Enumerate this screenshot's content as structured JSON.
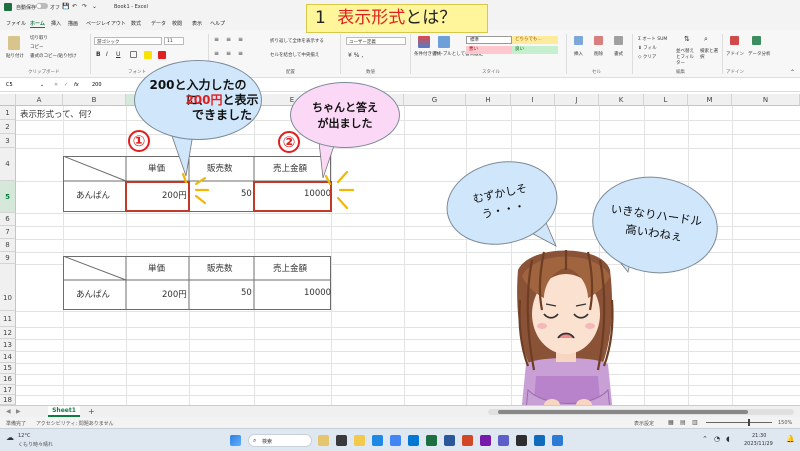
{
  "titlebar": {
    "autosave": "自動保存",
    "autosave_state": "オフ",
    "doc_title": "Book1 - Excel"
  },
  "menu": {
    "tabs": [
      "ファイル",
      "ホーム",
      "挿入",
      "描画",
      "ページレイアウト",
      "数式",
      "データ",
      "校閲",
      "表示",
      "ヘルプ"
    ],
    "active": "ホーム"
  },
  "ribbon": {
    "paste": "貼り付け",
    "cut": "切り取り",
    "copy": "コピー",
    "format_painter": "書式のコピー/貼り付け",
    "clipboard": "クリップボード",
    "font_name": "游ゴシック",
    "font_size": "11",
    "font_group": "フォント",
    "bold": "B",
    "italic": "I",
    "underline": "U",
    "wrap": "折り返して全体を表示する",
    "merge": "セルを結合して中央揃え",
    "align_group": "配置",
    "number_format": "ユーザー定義",
    "number_group": "数値",
    "cond_format": "条件付き書式",
    "table_format": "テーブルとして書式設定",
    "style_normal": "標準",
    "style_neutral": "どちらでも...",
    "style_bad": "悪い",
    "style_good": "良い",
    "style_group": "スタイル",
    "insert": "挿入",
    "delete": "削除",
    "format": "書式",
    "cell_group": "セル",
    "autosum": "オート SUM",
    "fill": "フィル",
    "clear": "クリア",
    "sort_filter": "並べ替えとフィルター",
    "find_select": "検索と選択",
    "edit_group": "編集",
    "addin": "アドイン",
    "addin_group": "アドイン",
    "data_analysis": "データ分析"
  },
  "formula_bar": {
    "name_box": "C5",
    "fx": "fx",
    "value": "200"
  },
  "grid": {
    "columns": [
      "A",
      "B",
      "C",
      "D",
      "E",
      "F",
      "G",
      "H",
      "I",
      "J",
      "K",
      "L",
      "M",
      "N"
    ],
    "rows": [
      "1",
      "2",
      "3",
      "4",
      "5",
      "6",
      "7",
      "8",
      "9",
      "10",
      "11",
      "12",
      "13",
      "14",
      "15",
      "16",
      "17",
      "18"
    ],
    "a1": "表示形式って、何？"
  },
  "table1": {
    "headers": [
      "単価",
      "販売数",
      "売上金額"
    ],
    "row_label": "あんぱん",
    "values": [
      "200円",
      "50",
      "10000"
    ]
  },
  "table2": {
    "headers": [
      "単価",
      "販売数",
      "売上金額"
    ],
    "row_label": "あんぱん",
    "values": [
      "200円",
      "50",
      "10000"
    ]
  },
  "slide_title": {
    "number": "1",
    "highlight": "表示形式",
    "rest": "とは？"
  },
  "callouts": {
    "marker1": "①",
    "marker2": "②",
    "bubble1_part1": "200と入力したのに、",
    "bubble1_red": "200円",
    "bubble1_part2": "と表示できました",
    "bubble2": "ちゃんと答えが出ました",
    "bubble3": "むずかしそう・・・",
    "bubble4": "いきなりハードル高いわねぇ"
  },
  "sheet_tabs": {
    "active": "Sheet1",
    "add": "+"
  },
  "status": {
    "ready": "準備完了",
    "accessibility": "アクセシビリティ: 問題ありません",
    "display_settings": "表示設定",
    "zoom": "150%"
  },
  "taskbar": {
    "weather_temp": "12°C",
    "weather_text": "くもり時々晴れ",
    "search": "検索",
    "time": "21:30",
    "date": "2023/11/29"
  },
  "colors": {
    "excel_green": "#107c41",
    "title_yellow": "#fff59a",
    "bubble_blue": "#cfe6fb",
    "bubble_pink": "#fbd9f6",
    "highlight_red": "#c0392b"
  }
}
